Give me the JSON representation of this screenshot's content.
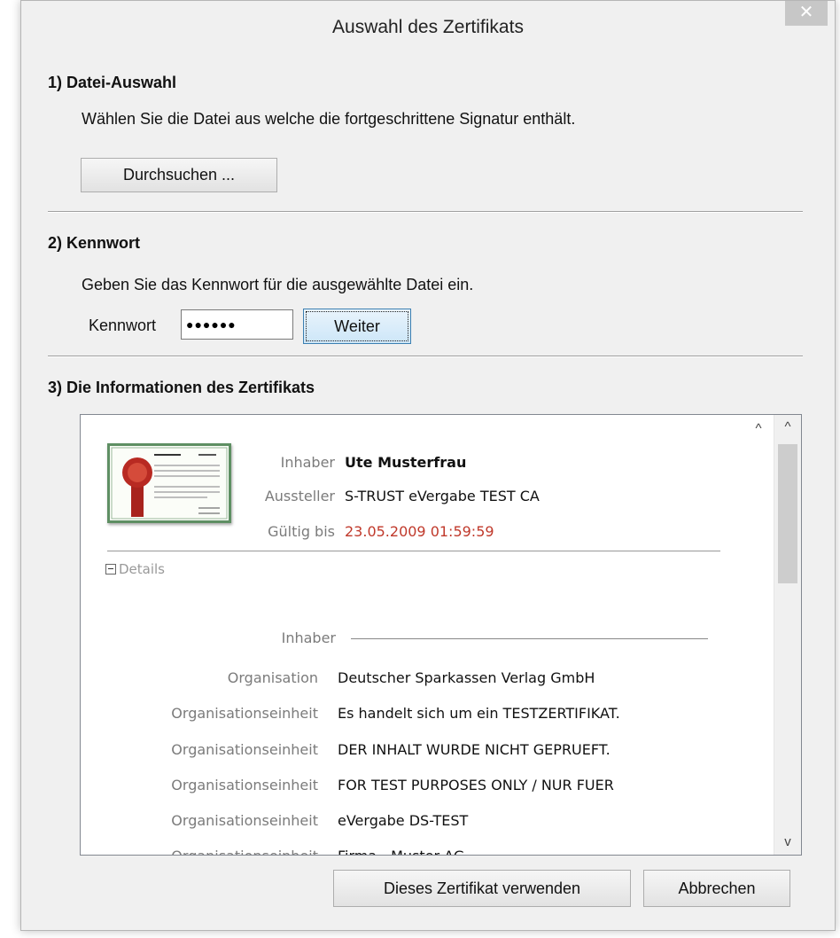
{
  "window": {
    "title": "Auswahl des Zertifikats",
    "close_glyph": "✕"
  },
  "section1": {
    "title": "1)  Datei-Auswahl",
    "text": "Wählen Sie die Datei aus welche die fortgeschrittene Signatur enthält.",
    "browse_button": "Durchsuchen ..."
  },
  "section2": {
    "title": "2)  Kennwort",
    "text": "Geben Sie das Kennwort für die ausgewählte Datei ein.",
    "password_label": "Kennwort",
    "password_value": "●●●●●●",
    "next_button": "Weiter"
  },
  "section3": {
    "title": "3)  Die Informationen des Zertifikats"
  },
  "certificate": {
    "holder_label": "Inhaber",
    "holder_value": "Ute Musterfrau",
    "issuer_label": "Aussteller",
    "issuer_value": "S-TRUST eVergabe TEST CA",
    "valid_label": "Gültig bis",
    "valid_value": "23.05.2009 01:59:59",
    "valid_color": "#c0392b",
    "details_label": "Details",
    "holder_section_label": "Inhaber",
    "rows": [
      {
        "label": "Organisation",
        "value": "Deutscher Sparkassen Verlag GmbH"
      },
      {
        "label": "Organisationseinheit",
        "value": "Es handelt sich um ein TESTZERTIFIKAT."
      },
      {
        "label": "Organisationseinheit",
        "value": "DER INHALT WURDE NICHT GEPRUEFT."
      },
      {
        "label": "Organisationseinheit",
        "value": "FOR TEST PURPOSES ONLY / NUR FUER"
      },
      {
        "label": "Organisationseinheit",
        "value": "eVergabe DS-TEST"
      },
      {
        "label": "Organisationseinheit",
        "value": "Firma - Muster AG"
      }
    ]
  },
  "footer": {
    "use_button": "Dieses Zertifikat verwenden",
    "cancel_button": "Abbrechen"
  },
  "icons": {
    "scroll_up": "^",
    "scroll_down": "v"
  }
}
